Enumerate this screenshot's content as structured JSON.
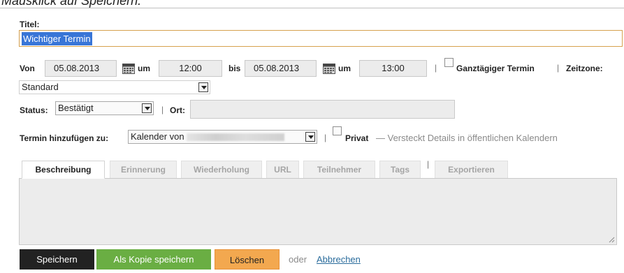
{
  "caption": "Mausklick auf Speichern.",
  "form": {
    "title_label": "Titel:",
    "title_value": "Wichtiger Termin",
    "von_label": "Von",
    "start_date": "05.08.2013",
    "um_label_1": "um",
    "start_time": "12:00",
    "bis_label": "bis",
    "end_date": "05.08.2013",
    "um_label_2": "um",
    "end_time": "13:00",
    "separator": "|",
    "all_day_label": "Ganztägiger Termin",
    "timezone_label": "Zeitzone:",
    "timezone_value": "Standard",
    "status_label": "Status:",
    "status_value": "Bestätigt",
    "ort_label": "Ort:",
    "ort_value": "",
    "add_to_label": "Termin hinzufügen zu:",
    "calendar_value": "Kalender von",
    "private_label": "Privat",
    "private_hint": "— Versteckt Details in öffentlichen Kalendern"
  },
  "tabs": [
    {
      "label": "Beschreibung",
      "active": true
    },
    {
      "label": "Erinnerung",
      "active": false
    },
    {
      "label": "Wiederholung",
      "active": false
    },
    {
      "label": "URL",
      "active": false
    },
    {
      "label": "Teilnehmer",
      "active": false
    },
    {
      "label": "Tags",
      "active": false
    },
    {
      "label": "Exportieren",
      "active": false
    }
  ],
  "tab_separator": "|",
  "buttons": {
    "save": "Speichern",
    "save_copy": "Als Kopie speichern",
    "delete": "Löschen",
    "or": "oder",
    "cancel": "Abbrechen"
  },
  "colors": {
    "save": "#222222",
    "save_copy": "#6aae43",
    "delete": "#f3a84f",
    "selection": "#3875d7",
    "title_border": "#d6a14e",
    "link": "#2a6c9c"
  }
}
